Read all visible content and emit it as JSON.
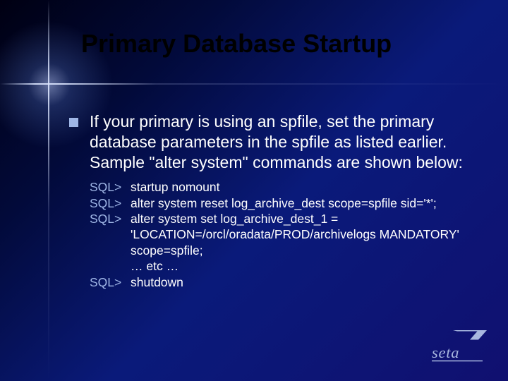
{
  "title": "Primary Database Startup",
  "bullet": "If your primary is using an spfile, set the primary database parameters in the spfile as listed earlier.  Sample \"alter system\" commands are shown below:",
  "sql": [
    {
      "prompt": "SQL>",
      "text": "startup nomount"
    },
    {
      "prompt": "SQL>",
      "text": "alter system reset log_archive_dest scope=spfile sid='*';"
    },
    {
      "prompt": "SQL>",
      "text": "alter system set log_archive_dest_1 = 'LOCATION=/orcl/oradata/PROD/archivelogs MANDATORY' scope=spfile;"
    },
    {
      "prompt": "",
      "text": "… etc …"
    },
    {
      "prompt": "SQL>",
      "text": "shutdown"
    }
  ],
  "logo_text": "seta"
}
